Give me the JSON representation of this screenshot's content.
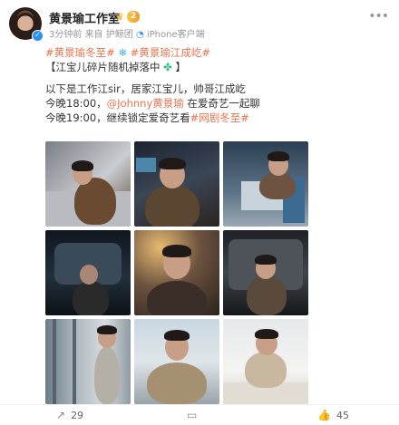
{
  "header": {
    "name": "黄景瑜工作室",
    "level_badge": "2",
    "meta_time": "3分钟前",
    "meta_source_prefix": "来自 护鲸团",
    "meta_source_suffix": "iPhone客户端",
    "more_icon": "more-dots-icon"
  },
  "post": {
    "tag1": "#黄景瑜冬至#",
    "tag2": "#黄景瑜江成屹#",
    "notice": "【江宝儿碎片随机掉落中",
    "notice_end": "】",
    "intro": "以下是工作江sir，居家江宝儿，帅哥江成屹",
    "line1_prefix": "今晚18:00，",
    "line1_mention": "@Johnny黄景瑜",
    "line1_suffix": " 在爱奇艺一起聊",
    "line2_prefix": "今晚19:00，继续锁定爱奇艺看",
    "line2_tag": "#网剧冬至#"
  },
  "photos": [
    {
      "label": "photo-1",
      "scene": "office-desk"
    },
    {
      "label": "photo-2",
      "scene": "night-smile"
    },
    {
      "label": "photo-3",
      "scene": "computer-lab"
    },
    {
      "label": "photo-4",
      "scene": "car-dark"
    },
    {
      "label": "photo-5",
      "scene": "warm-portrait"
    },
    {
      "label": "photo-6",
      "scene": "car-door"
    },
    {
      "label": "photo-7",
      "scene": "window-standing"
    },
    {
      "label": "photo-8",
      "scene": "city-outdoor"
    },
    {
      "label": "photo-9",
      "scene": "desk-writing"
    }
  ],
  "footer": {
    "repost_count": "29",
    "comment_count": "",
    "like_count": "45"
  },
  "colors": {
    "accent": "#eb7350",
    "link_blue": "#2a8ff7"
  }
}
